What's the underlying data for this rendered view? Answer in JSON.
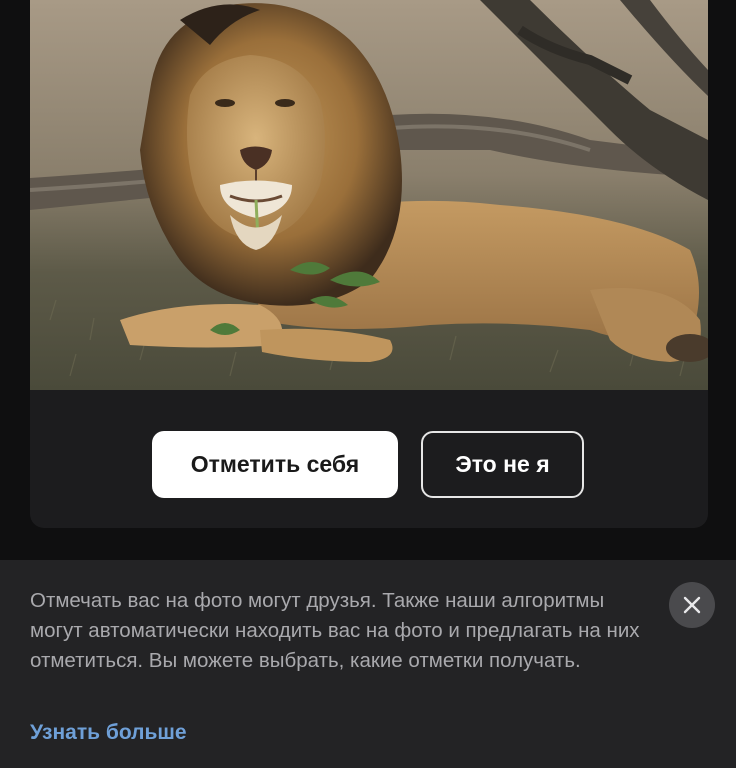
{
  "photo": {
    "subject": "lion"
  },
  "actions": {
    "tag_self_label": "Отметить себя",
    "not_me_label": "Это не я"
  },
  "info": {
    "text": "Отмечать вас на фото могут друзья. Также наши алгоритмы могут автоматически находить вас на фото и предлагать на них отметиться. Вы можете выбрать, какие отметки получать.",
    "link_label": "Узнать больше",
    "close_icon": "close-icon"
  },
  "colors": {
    "background": "#0f0f10",
    "card": "#1c1c1e",
    "info_panel": "#232325",
    "link": "#6fa0d8",
    "primary_button": "#ffffff"
  }
}
